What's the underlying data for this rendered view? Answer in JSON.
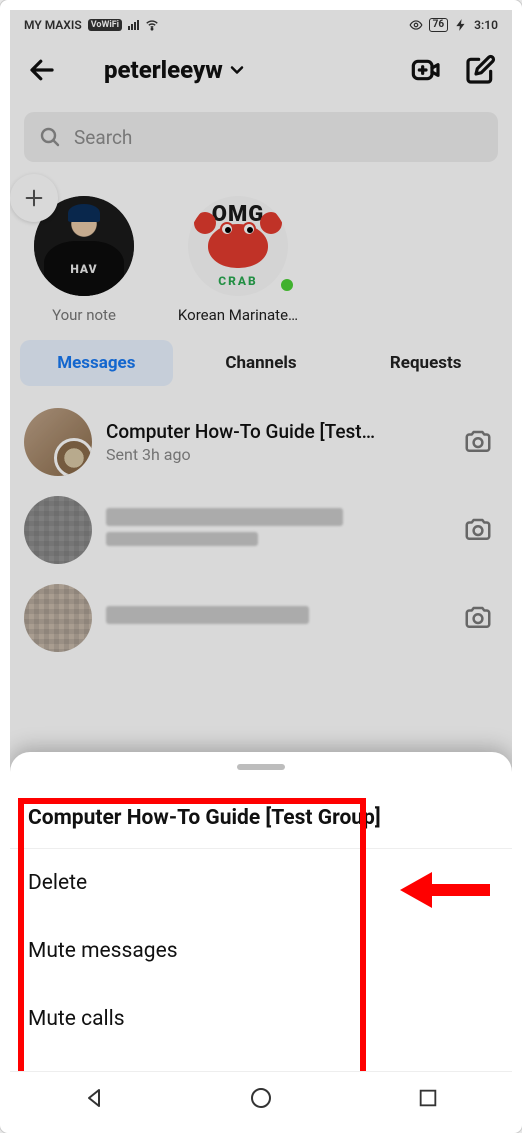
{
  "status": {
    "carrier": "MY MAXIS",
    "badge": "VoWiFi",
    "battery": "76",
    "time": "3:10"
  },
  "header": {
    "username": "peterleeyw"
  },
  "search": {
    "placeholder": "Search"
  },
  "notes": {
    "your_note_label": "Your note",
    "item2_label": "Korean Marinate…",
    "omg": "OMG",
    "crab": "CRAB",
    "tee": "HAV"
  },
  "tabs": {
    "messages": "Messages",
    "channels": "Channels",
    "requests": "Requests"
  },
  "chats": [
    {
      "title": "Computer How-To Guide [Test…",
      "sub": "Sent 3h ago"
    },
    {
      "title": "",
      "sub": ""
    },
    {
      "title": "",
      "sub": ""
    }
  ],
  "sheet": {
    "title": "Computer How-To Guide [Test Group]",
    "delete": "Delete",
    "mute_messages": "Mute messages",
    "mute_calls": "Mute calls"
  }
}
